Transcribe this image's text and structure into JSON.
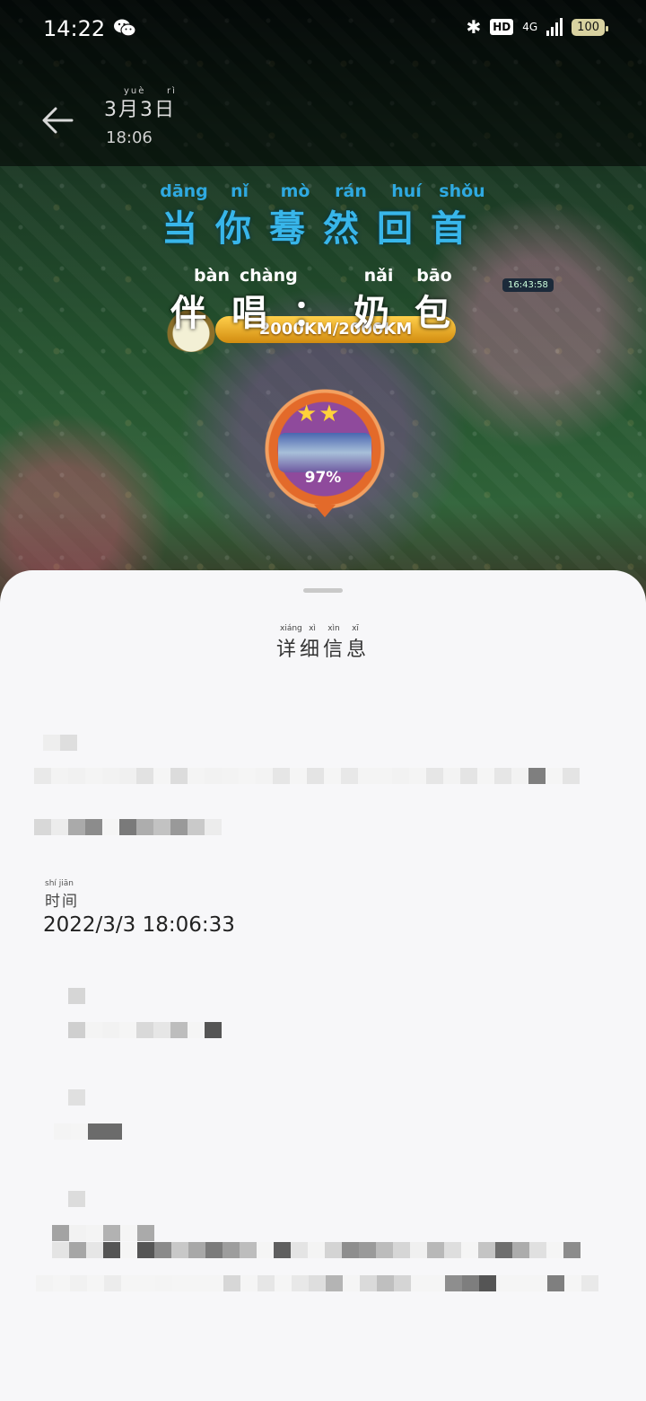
{
  "status_bar": {
    "time": "14:22",
    "network": "4G",
    "hd_label": "HD",
    "battery": "100"
  },
  "header": {
    "date_text": "3月3日",
    "date_pinyin_yue": "yuè",
    "date_pinyin_ri": "rì",
    "time_text": "18:06"
  },
  "lyrics": {
    "line1_pinyin": [
      "dāng",
      "nǐ",
      "mò",
      "rán",
      "huí",
      "shǒu"
    ],
    "line1_text": "当你蓦然回首",
    "line2_pinyin": [
      "bàn",
      "chàng",
      "",
      "nǎi",
      "bāo"
    ],
    "line2_text": "伴唱：奶包"
  },
  "game": {
    "distance": "2000KM/2000KM",
    "progress_percent": "97%",
    "stars": "★★",
    "clock_badge": "16:43:58"
  },
  "sheet": {
    "title_pinyin": [
      "xiáng",
      "xì",
      "xìn",
      "xī"
    ],
    "title": "详细信息",
    "time_label_pinyin": "shí jiān",
    "time_label": "时间",
    "time_value": "2022/3/3 18:06:33"
  },
  "colors": {
    "lyric_blue": "#38b6ea",
    "sheet_bg": "#f7f7f9",
    "km_bar": "#ffcf4a"
  }
}
